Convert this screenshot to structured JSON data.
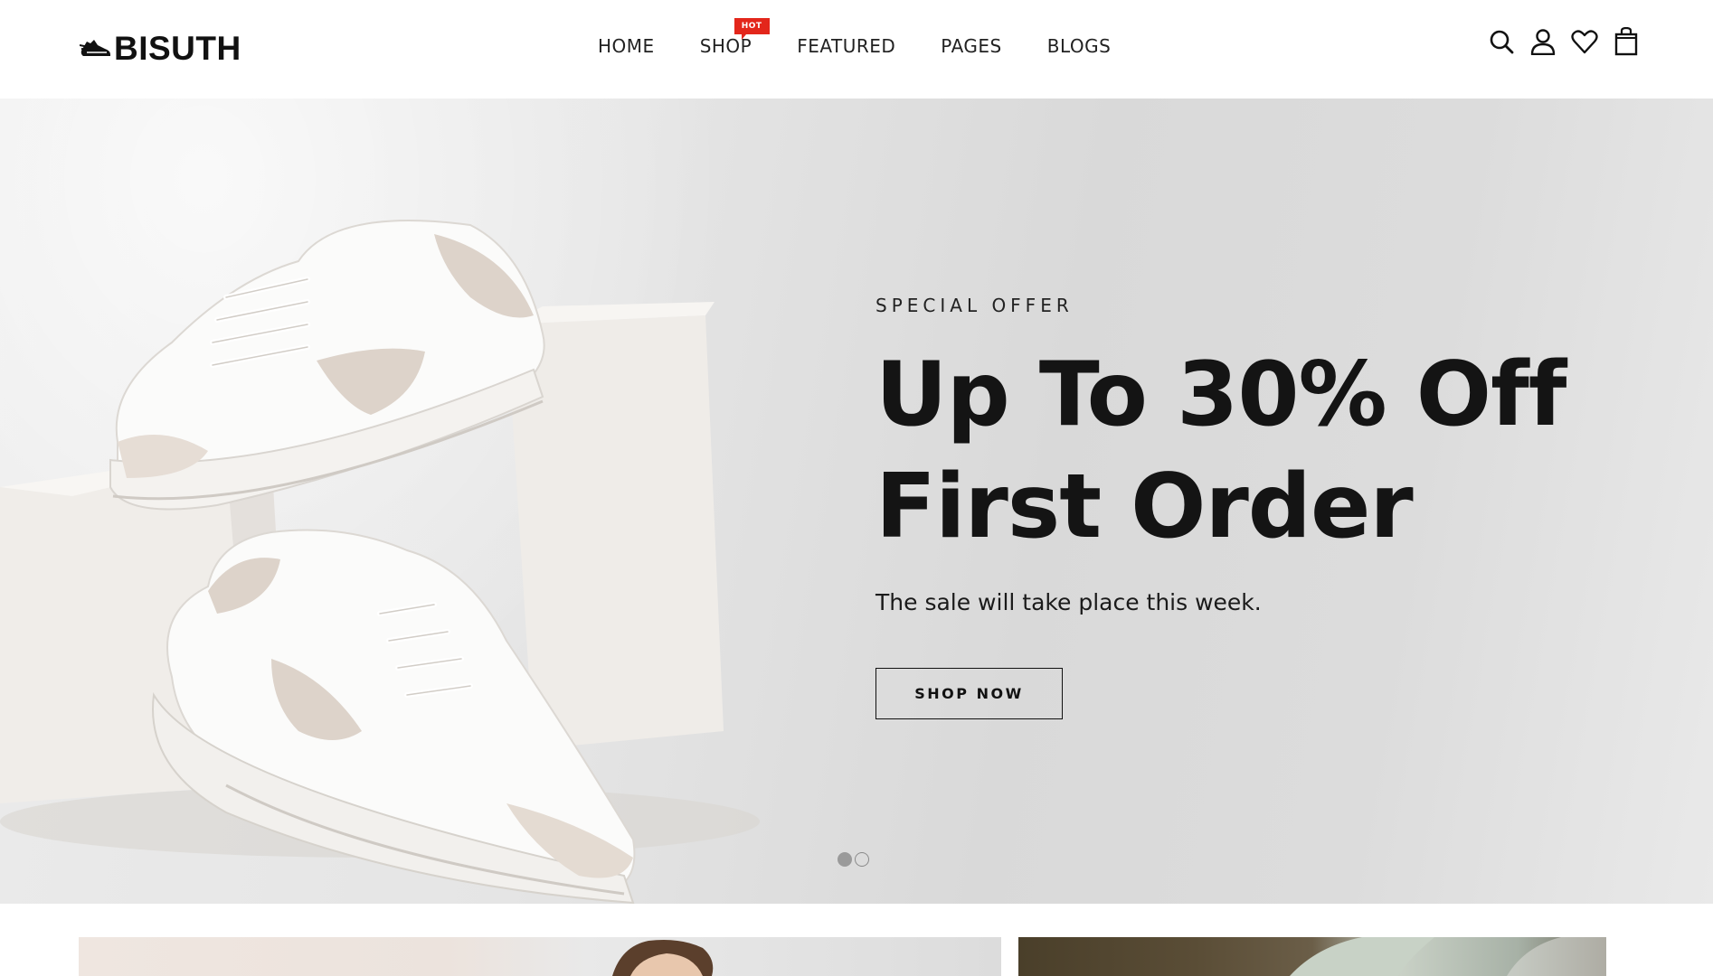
{
  "brand": {
    "name": "BISUTH",
    "logo_icon": "sneaker-icon"
  },
  "nav": {
    "items": [
      {
        "label": "HOME"
      },
      {
        "label": "SHOP",
        "badge": "HOT"
      },
      {
        "label": "FEATURED"
      },
      {
        "label": "PAGES"
      },
      {
        "label": "BLOGS"
      }
    ]
  },
  "header_icons": [
    "search-icon",
    "user-icon",
    "heart-icon",
    "shopping-bag-icon"
  ],
  "hero": {
    "eyebrow": "SPECIAL OFFER",
    "title_line1": "Up To 30% Off",
    "title_line2": "First Order",
    "subtitle": "The sale will take place this week.",
    "cta_label": "SHOP NOW",
    "slides_total": 2,
    "active_slide": 1
  },
  "colors": {
    "badge": "#e3261b",
    "text": "#141414",
    "hero_bg": "#dedede"
  }
}
